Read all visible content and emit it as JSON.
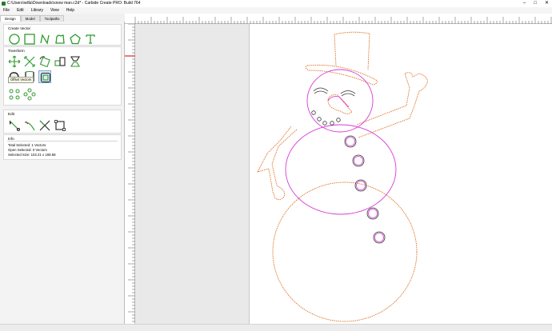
{
  "window": {
    "title": "C:\\Users\\willa\\Downloads\\snow man.c2d* - Carbide Create PRO: Build 764"
  },
  "menu": [
    "File",
    "Edit",
    "Library",
    "View",
    "Help"
  ],
  "tabs": [
    "Design",
    "Model",
    "Toolpaths"
  ],
  "create_vector": {
    "title": "Create Vector",
    "tools": [
      "circle-icon",
      "rectangle-icon",
      "curve-icon",
      "polygon-shape-icon",
      "pentagon-icon",
      "text-icon"
    ]
  },
  "transform": {
    "title": "Transform",
    "tooltip": "Offset Vectors",
    "tools": [
      "move-icon",
      "scale-icon",
      "rotate-icon",
      "align-icon",
      "mirror-icon",
      "boolean-icon",
      "join-icon",
      "offset-icon",
      "array-icon",
      "circular-array-icon"
    ]
  },
  "edit": {
    "title": "Edit",
    "tools": [
      "node-edit-icon",
      "smooth-icon",
      "trim-icon",
      "box-select-icon"
    ]
  },
  "info": {
    "title": "Info",
    "total_selected": "Total Selected:  1 Vectors",
    "open_selected": "Open Selected:  0 Vectors",
    "selected_size": "Selected Size:    102.21 x 169.58"
  },
  "colors": {
    "vector_orange": "#e06c1e",
    "selected_magenta": "#d63cd6",
    "tool_green": "#2e9a2e",
    "origin_red": "#dd2222"
  }
}
